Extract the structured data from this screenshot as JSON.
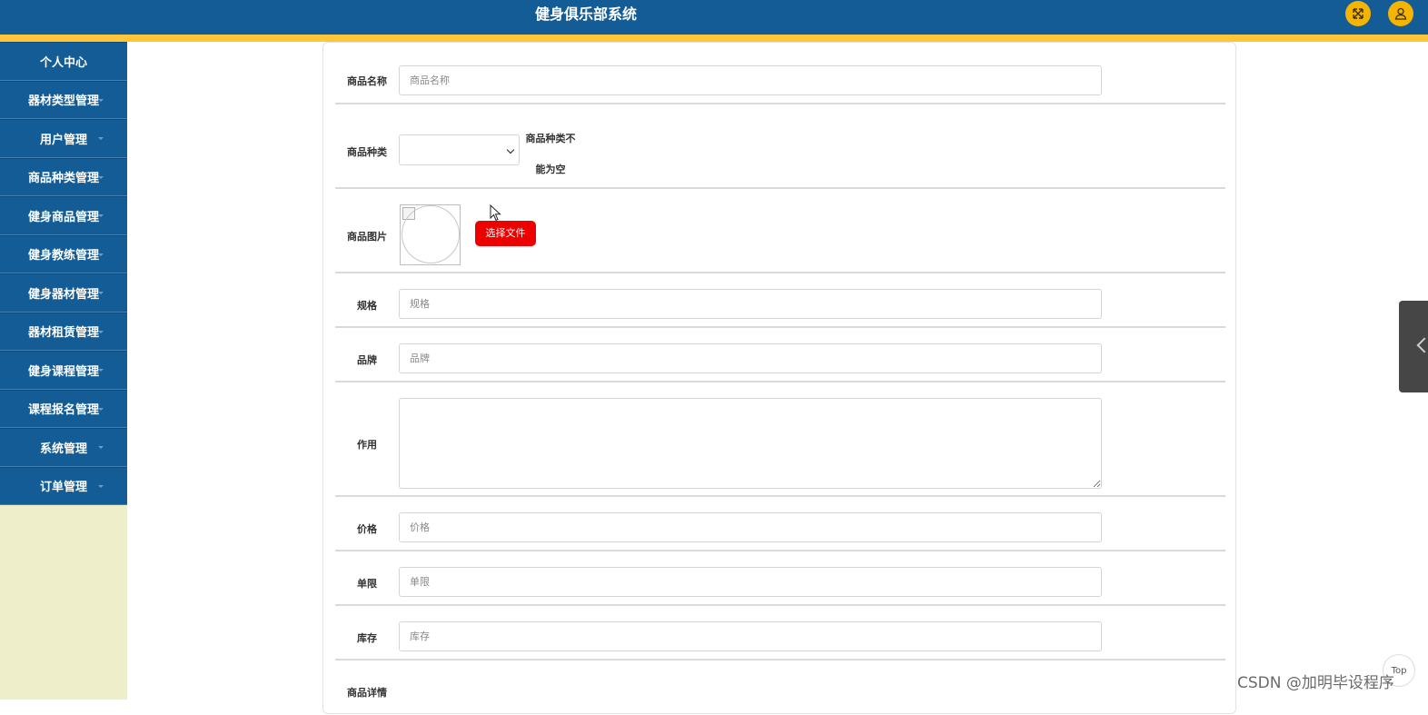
{
  "header": {
    "title": "健身俱乐部系统",
    "fullscreen_icon": "expand-icon",
    "user_icon": "user-icon",
    "bar_color": "#145c96",
    "accent_color": "#ffc63a"
  },
  "sidebar": {
    "items": [
      {
        "label": "个人中心",
        "has_caret": false
      },
      {
        "label": "器材类型管理",
        "has_caret": true
      },
      {
        "label": "用户管理",
        "has_caret": true
      },
      {
        "label": "商品种类管理",
        "has_caret": true
      },
      {
        "label": "健身商品管理",
        "has_caret": true
      },
      {
        "label": "健身教练管理",
        "has_caret": true
      },
      {
        "label": "健身器材管理",
        "has_caret": true
      },
      {
        "label": "器材租赁管理",
        "has_caret": true
      },
      {
        "label": "健身课程管理",
        "has_caret": true
      },
      {
        "label": "课程报名管理",
        "has_caret": true
      },
      {
        "label": "系统管理",
        "has_caret": true
      },
      {
        "label": "订单管理",
        "has_caret": true
      }
    ]
  },
  "form": {
    "name": {
      "label": "商品名称",
      "placeholder": "商品名称",
      "value": ""
    },
    "category": {
      "label": "商品种类",
      "value": "",
      "error": "商品种类不能为空"
    },
    "image": {
      "label": "商品图片",
      "button_label": "选择文件",
      "button_color": "#ef0000"
    },
    "spec": {
      "label": "规格",
      "placeholder": "规格",
      "value": ""
    },
    "brand": {
      "label": "品牌",
      "placeholder": "品牌",
      "value": ""
    },
    "effect": {
      "label": "作用",
      "value": ""
    },
    "price": {
      "label": "价格",
      "placeholder": "价格",
      "value": ""
    },
    "limit": {
      "label": "单限",
      "placeholder": "单限",
      "value": ""
    },
    "stock": {
      "label": "库存",
      "placeholder": "库存",
      "value": ""
    },
    "detail": {
      "label": "商品详情"
    }
  },
  "misc": {
    "top_button_label": "Top",
    "watermark": "CSDN @加明毕设程序"
  }
}
